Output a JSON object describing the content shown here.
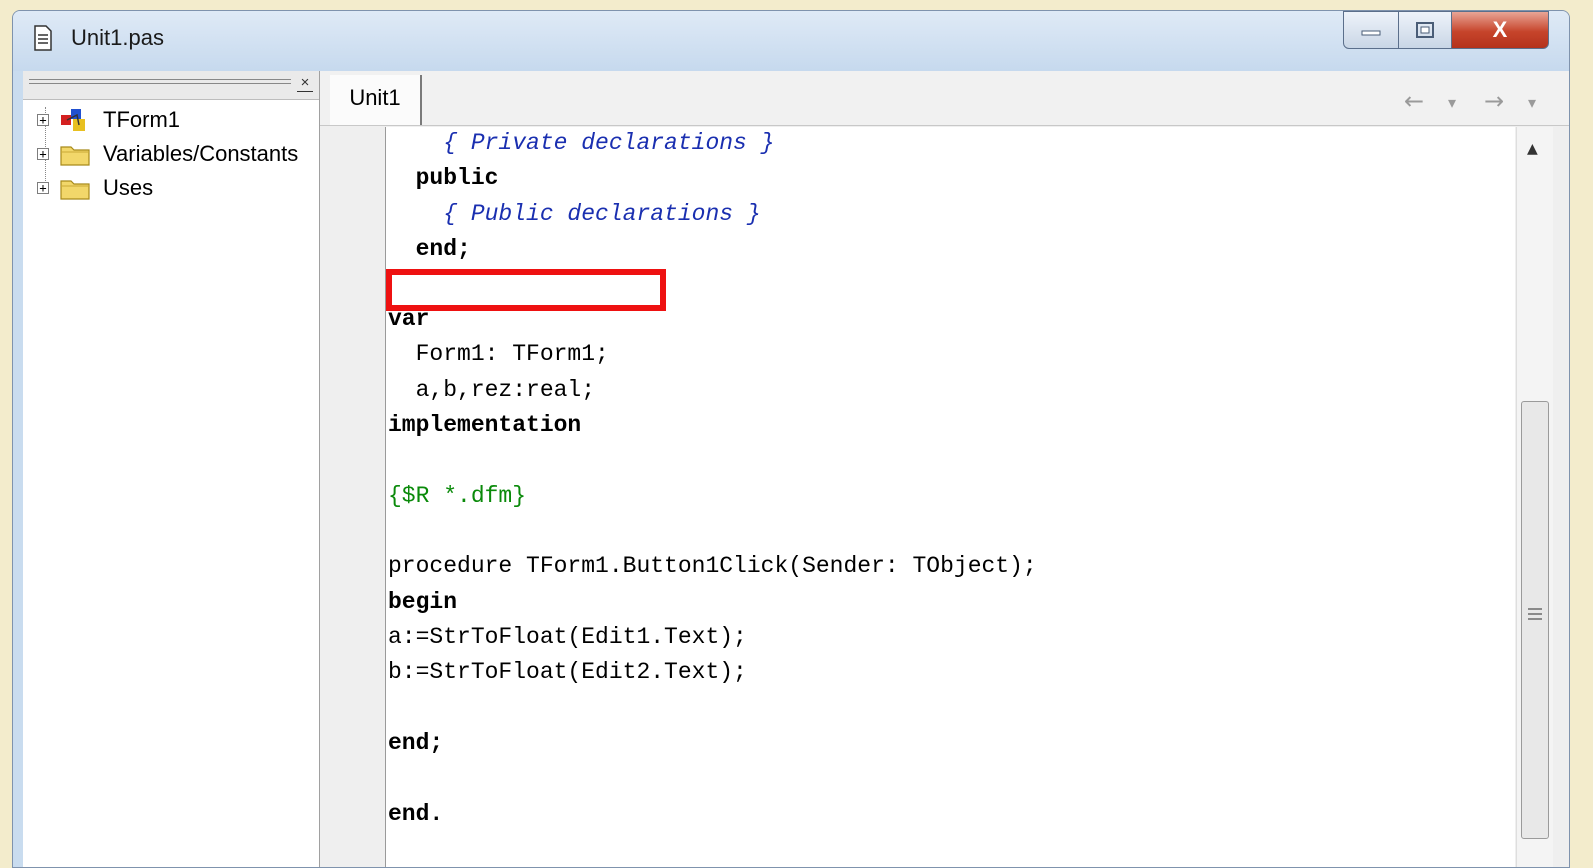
{
  "window": {
    "title": "Unit1.pas"
  },
  "controls": {
    "minimize": "—",
    "maximize": "▢",
    "close": "X"
  },
  "left_panel": {
    "tree": [
      {
        "label": "TForm1",
        "icon": "form-icon"
      },
      {
        "label": "Variables/Constants",
        "icon": "folder-icon"
      },
      {
        "label": "Uses",
        "icon": "folder-icon"
      }
    ]
  },
  "editor": {
    "tab_label": "Unit1",
    "nav": {
      "back": "←",
      "forward": "→"
    },
    "lines": [
      "    { Private declarations }",
      "  public",
      "    { Public declarations }",
      "  end;",
      "",
      "var",
      "  Form1: TForm1;",
      "  a,b,rez:real;",
      "implementation",
      "",
      "{$R *.dfm}",
      "",
      "procedure TForm1.Button1Click(Sender: TObject);",
      "begin",
      "a:=StrToFloat(Edit1.Text);",
      "b:=StrToFloat(Edit2.Text);",
      "",
      "end;",
      "",
      "end."
    ]
  },
  "colors": {
    "comment": "#1a2fb0",
    "directive": "#0a8a0a",
    "highlight_box": "#ee1111"
  }
}
